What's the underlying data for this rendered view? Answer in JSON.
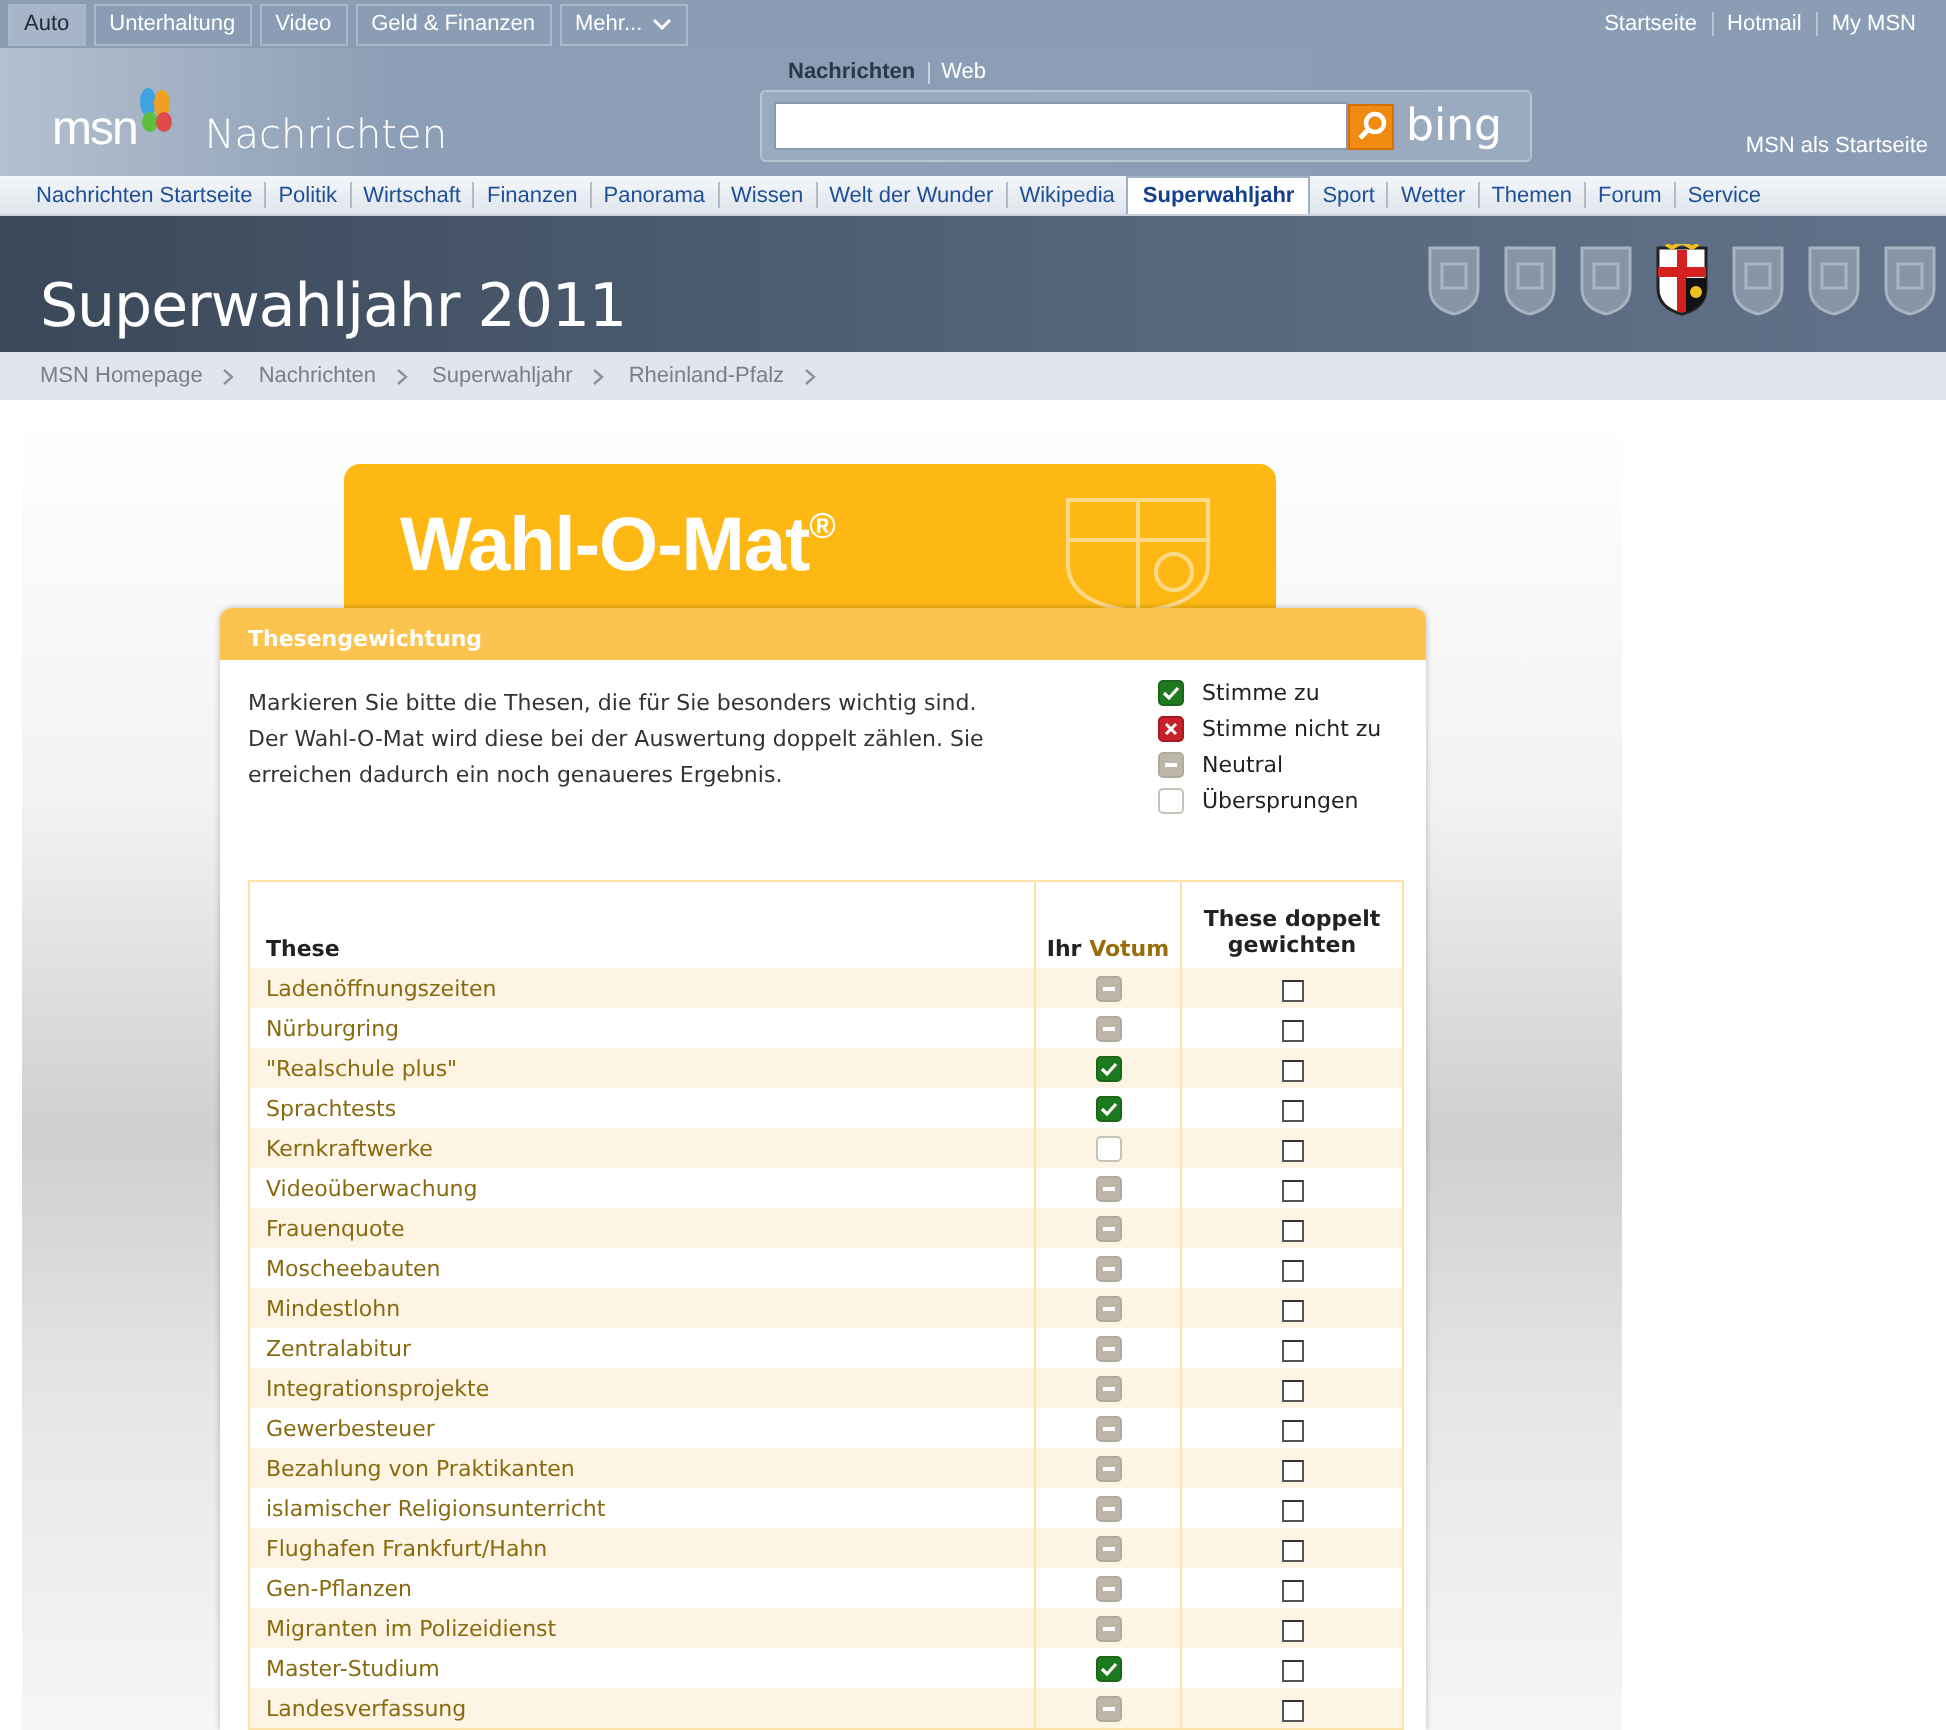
{
  "top_bar": {
    "tabs": [
      {
        "label": "Auto",
        "selected": true
      },
      {
        "label": "Unterhaltung",
        "selected": false
      },
      {
        "label": "Video",
        "selected": false
      },
      {
        "label": "Geld & Finanzen",
        "selected": false
      },
      {
        "label": "Mehr...",
        "selected": false,
        "kind": "menu"
      }
    ],
    "links": [
      "Startseite",
      "Hotmail",
      "My MSN"
    ]
  },
  "header": {
    "logo": "msn",
    "section": "Nachrichten",
    "search_tabs": [
      {
        "label": "Nachrichten",
        "selected": true
      },
      {
        "label": "Web",
        "selected": false
      }
    ],
    "search_brand": "bing",
    "homepage_link": "MSN als Startseite"
  },
  "nav": [
    {
      "label": "Nachrichten Startseite",
      "selected": false
    },
    {
      "label": "Politik",
      "selected": false
    },
    {
      "label": "Wirtschaft",
      "selected": false
    },
    {
      "label": "Finanzen",
      "selected": false
    },
    {
      "label": "Panorama",
      "selected": false
    },
    {
      "label": "Wissen",
      "selected": false
    },
    {
      "label": "Welt der Wunder",
      "selected": false
    },
    {
      "label": "Wikipedia",
      "selected": false
    },
    {
      "label": "Superwahljahr",
      "selected": true
    },
    {
      "label": "Sport",
      "selected": false
    },
    {
      "label": "Wetter",
      "selected": false
    },
    {
      "label": "Themen",
      "selected": false
    },
    {
      "label": "Forum",
      "selected": false
    },
    {
      "label": "Service",
      "selected": false
    }
  ],
  "banner": {
    "title": "Superwahljahr 2011",
    "emblems": [
      {
        "selected": false
      },
      {
        "selected": false
      },
      {
        "selected": false
      },
      {
        "selected": true
      },
      {
        "selected": false
      },
      {
        "selected": false
      },
      {
        "selected": false
      }
    ]
  },
  "breadcrumb": [
    "MSN Homepage",
    "Nachrichten",
    "Superwahljahr",
    "Rheinland-Pfalz"
  ],
  "card": {
    "title": "Wahl-O-Mat$^{®}$"
  },
  "dialog": {
    "title": "Thesengewichtung",
    "intro": "Markieren Sie bitte die Thesen, die für Sie besonders wichtig sind. Der Wahl-O-Mat wird diese bei der Auswertung doppelt zählen. Sie erreichen dadurch ein noch genaueres Ergebnis.",
    "legend": [
      {
        "kind": "agree",
        "label": "Stimme zu"
      },
      {
        "kind": "disagree",
        "label": "Stimme nicht zu"
      },
      {
        "kind": "neutral",
        "label": "Neutral"
      },
      {
        "kind": "skipped",
        "label": "Übersprungen"
      }
    ],
    "columns": [
      {
        "label": "These"
      },
      {
        "label": "Ihr",
        "accent": "Votum"
      },
      {
        "label": "These doppelt gewichten"
      }
    ],
    "rows": [
      {
        "these": "Ladenöffnungszeiten",
        "kind": "neutral",
        "checked": false
      },
      {
        "these": "Nürburgring",
        "kind": "neutral",
        "checked": false
      },
      {
        "these": "\"Realschule plus\"",
        "kind": "agree",
        "checked": false
      },
      {
        "these": "Sprachtests",
        "kind": "agree",
        "checked": false
      },
      {
        "these": "Kernkraftwerke",
        "kind": "skipped",
        "checked": false
      },
      {
        "these": "Videoüberwachung",
        "kind": "neutral",
        "checked": false
      },
      {
        "these": "Frauenquote",
        "kind": "neutral",
        "checked": false
      },
      {
        "these": "Moscheebauten",
        "kind": "neutral",
        "checked": false
      },
      {
        "these": "Mindestlohn",
        "kind": "neutral",
        "checked": false
      },
      {
        "these": "Zentralabitur",
        "kind": "neutral",
        "checked": false
      },
      {
        "these": "Integrationsprojekte",
        "kind": "neutral",
        "checked": false
      },
      {
        "these": "Gewerbesteuer",
        "kind": "neutral",
        "checked": false
      },
      {
        "these": "Bezahlung von Praktikanten",
        "kind": "neutral",
        "checked": false
      },
      {
        "these": "islamischer Religionsunterricht",
        "kind": "neutral",
        "checked": false
      },
      {
        "these": "Flughafen Frankfurt/Hahn",
        "kind": "neutral",
        "checked": false
      },
      {
        "these": "Gen-Pflanzen",
        "kind": "neutral",
        "checked": false
      },
      {
        "these": "Migranten im Polizeidienst",
        "kind": "neutral",
        "checked": false
      },
      {
        "these": "Master-Studium",
        "kind": "agree",
        "checked": false
      },
      {
        "these": "Landesverfassung",
        "kind": "neutral",
        "checked": false
      }
    ]
  }
}
